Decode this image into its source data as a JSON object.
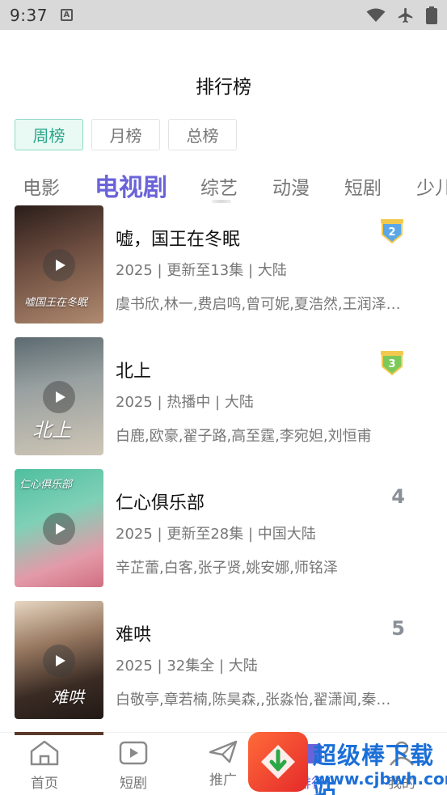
{
  "status_bar": {
    "time": "9:37",
    "badge_letter": "A"
  },
  "page_title": "排行榜",
  "period_tabs": [
    {
      "label": "周榜",
      "active": true
    },
    {
      "label": "月榜",
      "active": false
    },
    {
      "label": "总榜",
      "active": false
    }
  ],
  "category_tabs": [
    {
      "label": "电影",
      "active": false
    },
    {
      "label": "电视剧",
      "active": true
    },
    {
      "label": "综艺",
      "active": false
    },
    {
      "label": "动漫",
      "active": false
    },
    {
      "label": "短剧",
      "active": false
    },
    {
      "label": "少儿",
      "active": false
    }
  ],
  "items": [
    {
      "rank": "2",
      "rank_style": "medal-blue",
      "title": "嘘，国王在冬眠",
      "meta": "2025 | 更新至13集 | 大陆",
      "cast": "虞书欣,林一,费启鸣,曾可妮,夏浩然,王润泽…",
      "poster_text": "嘘国王在冬眠",
      "poster_colors": [
        "#3a2a25",
        "#8a6a5a"
      ]
    },
    {
      "rank": "3",
      "rank_style": "medal-green",
      "title": "北上",
      "meta": "2025 | 热播中 | 大陆",
      "cast": "白鹿,欧豪,翟子路,高至霆,李宛妲,刘恒甫",
      "poster_text": "北上",
      "poster_colors": [
        "#6f7a80",
        "#b9b3a8"
      ]
    },
    {
      "rank": "4",
      "rank_style": "number",
      "title": "仁心俱乐部",
      "meta": "2025 | 更新至28集 | 中国大陆",
      "cast": "辛芷蕾,白客,张子贤,姚安娜,师铭泽",
      "poster_text": "仁心俱乐部",
      "poster_colors": [
        "#48b49a",
        "#e07a8a"
      ]
    },
    {
      "rank": "5",
      "rank_style": "number",
      "title": "难哄",
      "meta": "2025 | 32集全 | 大陆",
      "cast": "白敬亭,章若楠,陈昊森,,张淼怡,翟潇闻,秦…",
      "poster_text": "难哄",
      "poster_colors": [
        "#2f241f",
        "#c9a184"
      ]
    }
  ],
  "bottom_nav": [
    {
      "label": "首页",
      "icon": "home-icon"
    },
    {
      "label": "短剧",
      "icon": "play-box-icon"
    },
    {
      "label": "推广",
      "icon": "send-icon"
    },
    {
      "label": "排行",
      "icon": "rank-icon"
    },
    {
      "label": "我的",
      "icon": "user-icon"
    }
  ],
  "watermark": {
    "title": "超级棒下载站",
    "url": "www.cjbwh.com"
  },
  "colors": {
    "accent": "#6a63d8",
    "tab_active_bg": "#e9f9f4",
    "tab_active_text": "#2ba78a",
    "status_bar": "#d9d9d9"
  }
}
